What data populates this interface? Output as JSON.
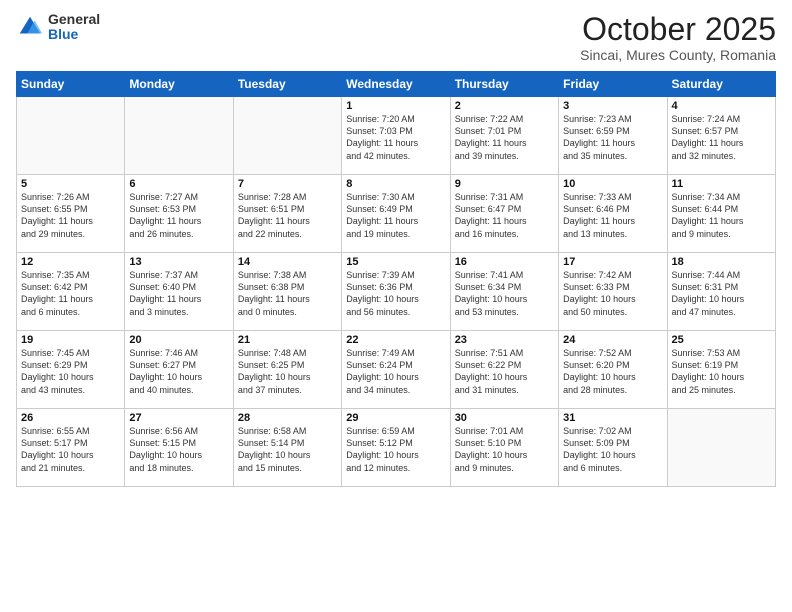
{
  "logo": {
    "general": "General",
    "blue": "Blue"
  },
  "header": {
    "title": "October 2025",
    "subtitle": "Sincai, Mures County, Romania"
  },
  "days_of_week": [
    "Sunday",
    "Monday",
    "Tuesday",
    "Wednesday",
    "Thursday",
    "Friday",
    "Saturday"
  ],
  "weeks": [
    [
      {
        "day": "",
        "info": ""
      },
      {
        "day": "",
        "info": ""
      },
      {
        "day": "",
        "info": ""
      },
      {
        "day": "1",
        "info": "Sunrise: 7:20 AM\nSunset: 7:03 PM\nDaylight: 11 hours\nand 42 minutes."
      },
      {
        "day": "2",
        "info": "Sunrise: 7:22 AM\nSunset: 7:01 PM\nDaylight: 11 hours\nand 39 minutes."
      },
      {
        "day": "3",
        "info": "Sunrise: 7:23 AM\nSunset: 6:59 PM\nDaylight: 11 hours\nand 35 minutes."
      },
      {
        "day": "4",
        "info": "Sunrise: 7:24 AM\nSunset: 6:57 PM\nDaylight: 11 hours\nand 32 minutes."
      }
    ],
    [
      {
        "day": "5",
        "info": "Sunrise: 7:26 AM\nSunset: 6:55 PM\nDaylight: 11 hours\nand 29 minutes."
      },
      {
        "day": "6",
        "info": "Sunrise: 7:27 AM\nSunset: 6:53 PM\nDaylight: 11 hours\nand 26 minutes."
      },
      {
        "day": "7",
        "info": "Sunrise: 7:28 AM\nSunset: 6:51 PM\nDaylight: 11 hours\nand 22 minutes."
      },
      {
        "day": "8",
        "info": "Sunrise: 7:30 AM\nSunset: 6:49 PM\nDaylight: 11 hours\nand 19 minutes."
      },
      {
        "day": "9",
        "info": "Sunrise: 7:31 AM\nSunset: 6:47 PM\nDaylight: 11 hours\nand 16 minutes."
      },
      {
        "day": "10",
        "info": "Sunrise: 7:33 AM\nSunset: 6:46 PM\nDaylight: 11 hours\nand 13 minutes."
      },
      {
        "day": "11",
        "info": "Sunrise: 7:34 AM\nSunset: 6:44 PM\nDaylight: 11 hours\nand 9 minutes."
      }
    ],
    [
      {
        "day": "12",
        "info": "Sunrise: 7:35 AM\nSunset: 6:42 PM\nDaylight: 11 hours\nand 6 minutes."
      },
      {
        "day": "13",
        "info": "Sunrise: 7:37 AM\nSunset: 6:40 PM\nDaylight: 11 hours\nand 3 minutes."
      },
      {
        "day": "14",
        "info": "Sunrise: 7:38 AM\nSunset: 6:38 PM\nDaylight: 11 hours\nand 0 minutes."
      },
      {
        "day": "15",
        "info": "Sunrise: 7:39 AM\nSunset: 6:36 PM\nDaylight: 10 hours\nand 56 minutes."
      },
      {
        "day": "16",
        "info": "Sunrise: 7:41 AM\nSunset: 6:34 PM\nDaylight: 10 hours\nand 53 minutes."
      },
      {
        "day": "17",
        "info": "Sunrise: 7:42 AM\nSunset: 6:33 PM\nDaylight: 10 hours\nand 50 minutes."
      },
      {
        "day": "18",
        "info": "Sunrise: 7:44 AM\nSunset: 6:31 PM\nDaylight: 10 hours\nand 47 minutes."
      }
    ],
    [
      {
        "day": "19",
        "info": "Sunrise: 7:45 AM\nSunset: 6:29 PM\nDaylight: 10 hours\nand 43 minutes."
      },
      {
        "day": "20",
        "info": "Sunrise: 7:46 AM\nSunset: 6:27 PM\nDaylight: 10 hours\nand 40 minutes."
      },
      {
        "day": "21",
        "info": "Sunrise: 7:48 AM\nSunset: 6:25 PM\nDaylight: 10 hours\nand 37 minutes."
      },
      {
        "day": "22",
        "info": "Sunrise: 7:49 AM\nSunset: 6:24 PM\nDaylight: 10 hours\nand 34 minutes."
      },
      {
        "day": "23",
        "info": "Sunrise: 7:51 AM\nSunset: 6:22 PM\nDaylight: 10 hours\nand 31 minutes."
      },
      {
        "day": "24",
        "info": "Sunrise: 7:52 AM\nSunset: 6:20 PM\nDaylight: 10 hours\nand 28 minutes."
      },
      {
        "day": "25",
        "info": "Sunrise: 7:53 AM\nSunset: 6:19 PM\nDaylight: 10 hours\nand 25 minutes."
      }
    ],
    [
      {
        "day": "26",
        "info": "Sunrise: 6:55 AM\nSunset: 5:17 PM\nDaylight: 10 hours\nand 21 minutes."
      },
      {
        "day": "27",
        "info": "Sunrise: 6:56 AM\nSunset: 5:15 PM\nDaylight: 10 hours\nand 18 minutes."
      },
      {
        "day": "28",
        "info": "Sunrise: 6:58 AM\nSunset: 5:14 PM\nDaylight: 10 hours\nand 15 minutes."
      },
      {
        "day": "29",
        "info": "Sunrise: 6:59 AM\nSunset: 5:12 PM\nDaylight: 10 hours\nand 12 minutes."
      },
      {
        "day": "30",
        "info": "Sunrise: 7:01 AM\nSunset: 5:10 PM\nDaylight: 10 hours\nand 9 minutes."
      },
      {
        "day": "31",
        "info": "Sunrise: 7:02 AM\nSunset: 5:09 PM\nDaylight: 10 hours\nand 6 minutes."
      },
      {
        "day": "",
        "info": ""
      }
    ]
  ]
}
